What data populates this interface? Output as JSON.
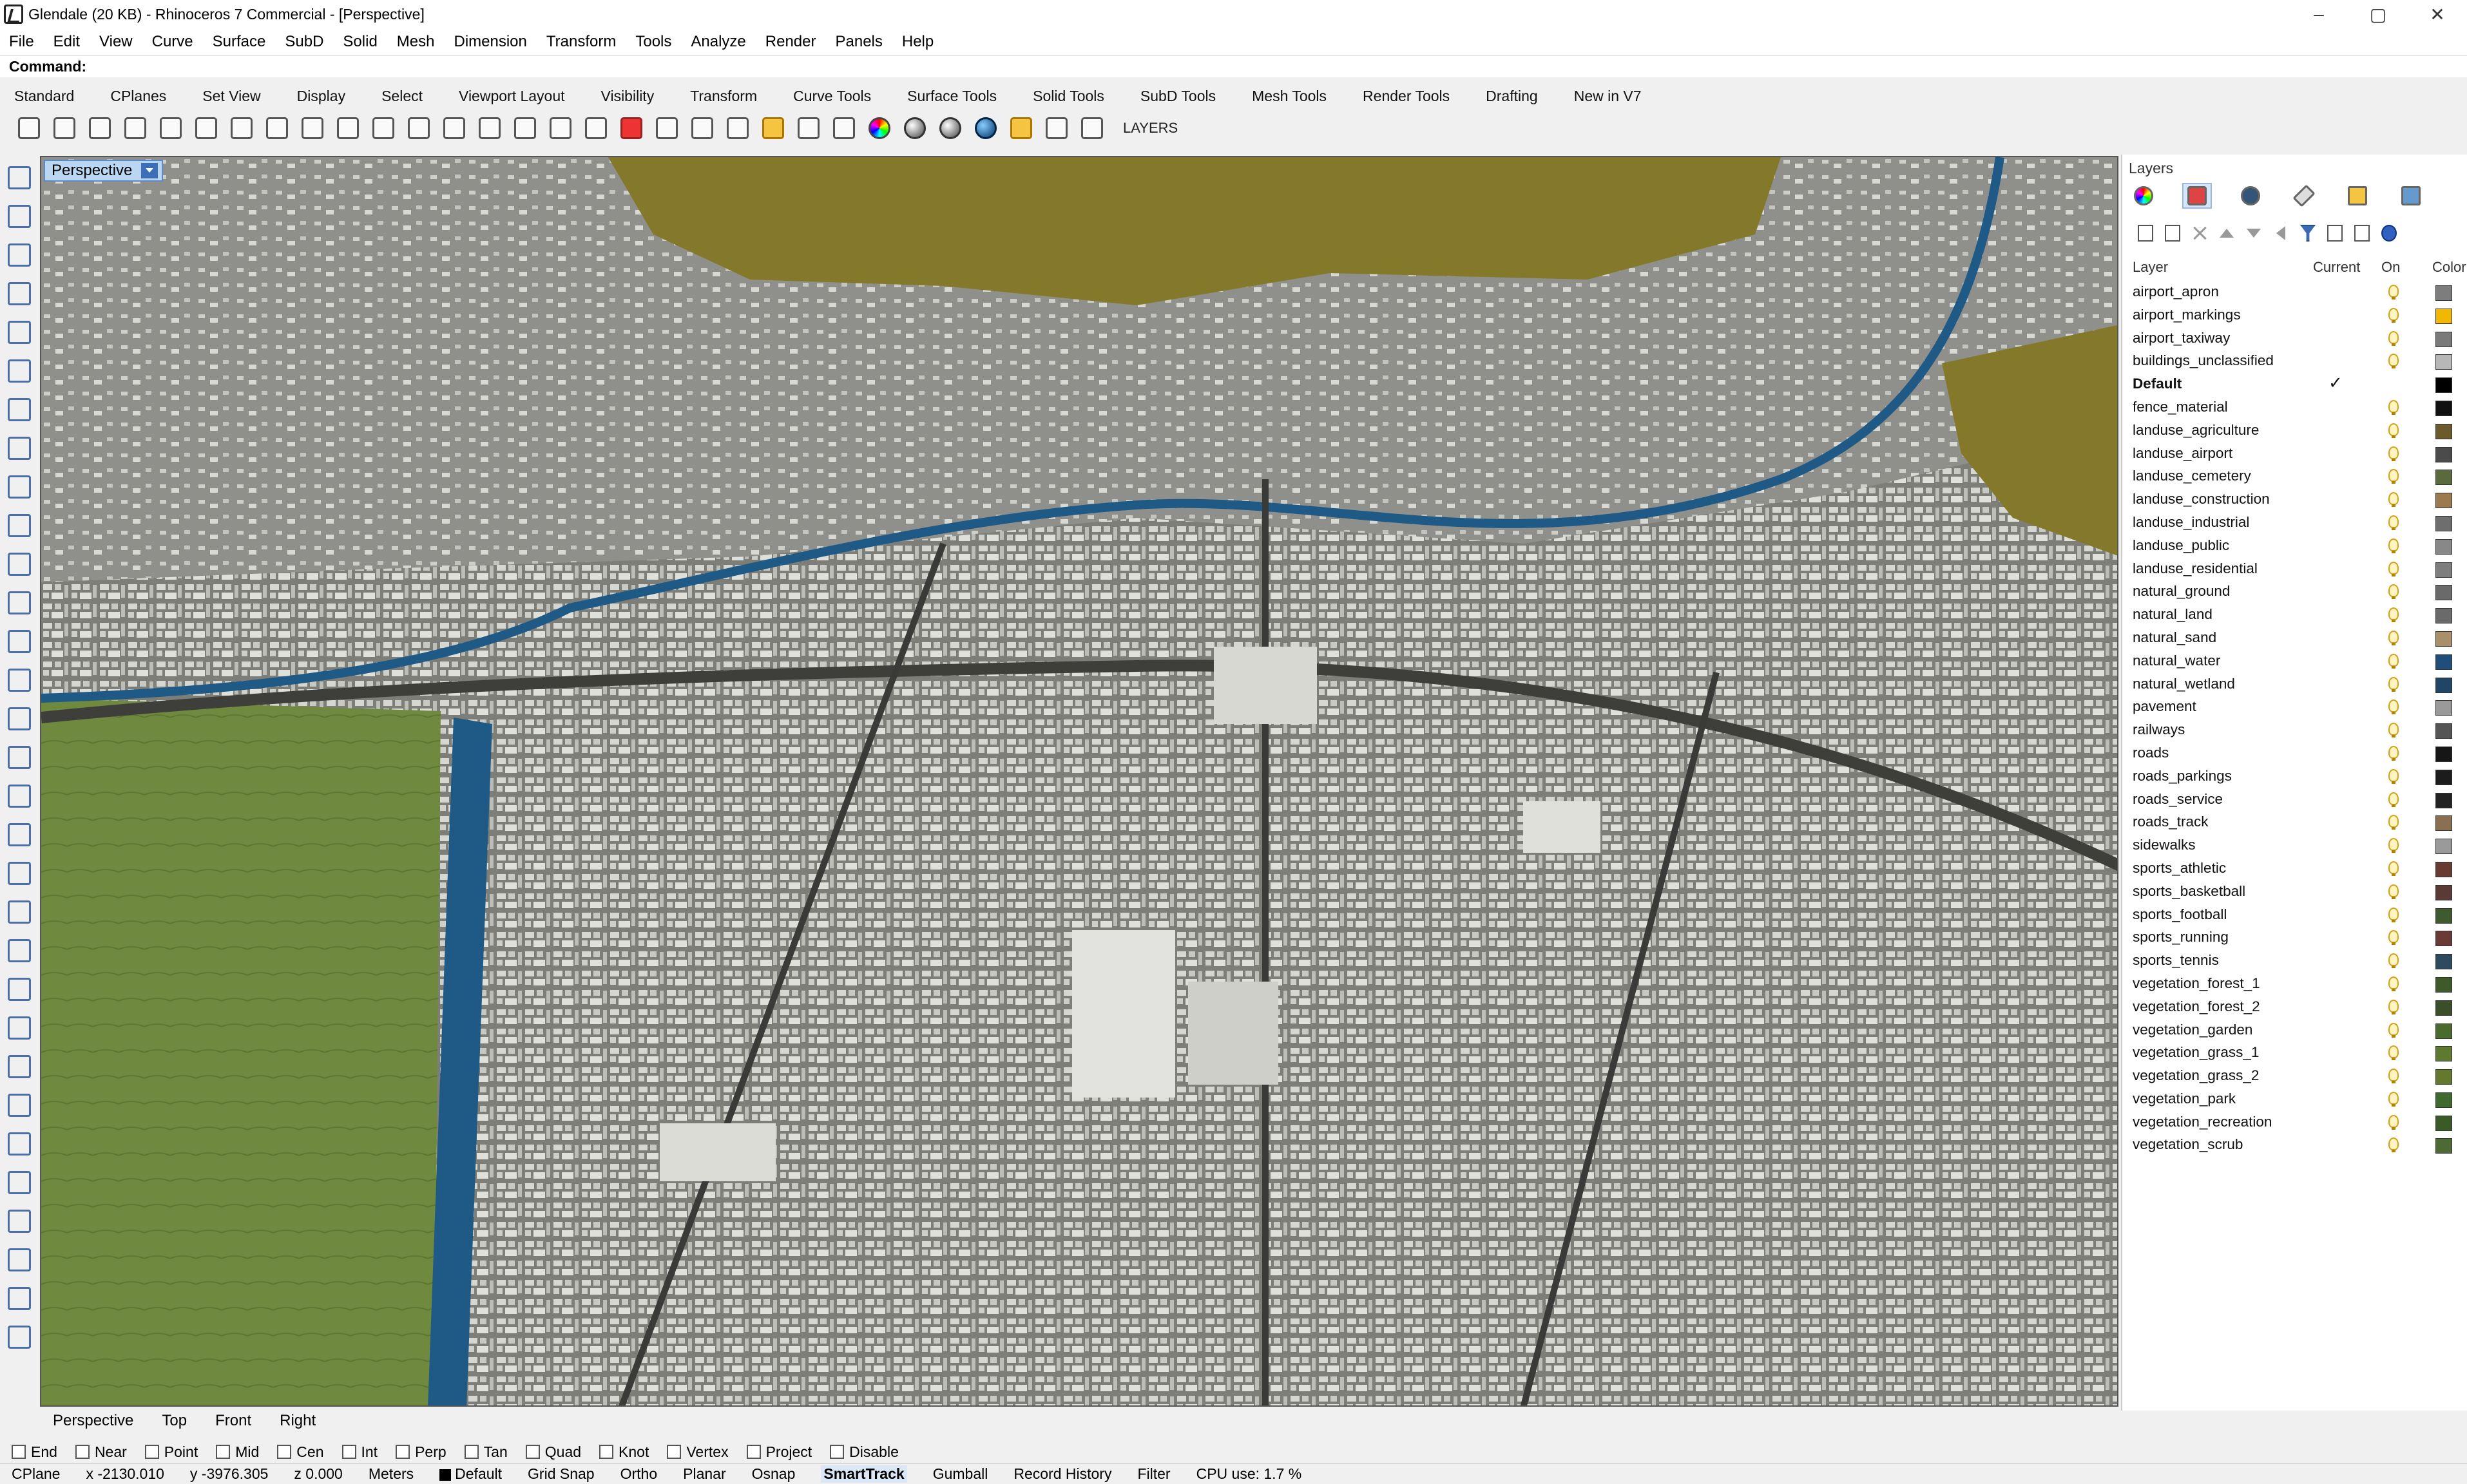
{
  "window": {
    "title": "Glendale (20 KB) - Rhinoceros 7 Commercial - [Perspective]",
    "controls": [
      "–",
      "▢",
      "✕"
    ]
  },
  "menu": [
    "File",
    "Edit",
    "View",
    "Curve",
    "Surface",
    "SubD",
    "Solid",
    "Mesh",
    "Dimension",
    "Transform",
    "Tools",
    "Analyze",
    "Render",
    "Panels",
    "Help"
  ],
  "command": {
    "label": "Command:",
    "value": ""
  },
  "toolbar_tabs": [
    "Standard",
    "CPlanes",
    "Set View",
    "Display",
    "Select",
    "Viewport Layout",
    "Visibility",
    "Transform",
    "Curve Tools",
    "Surface Tools",
    "Solid Tools",
    "SubD Tools",
    "Mesh Tools",
    "Render Tools",
    "Drafting",
    "New in V7"
  ],
  "toolbar": {
    "layers_label": "LAYERS",
    "icons": [
      "new-file-icon",
      "open-folder-icon",
      "save-icon",
      "print-icon",
      "import-icon",
      "cut-icon",
      "copy-icon",
      "paste-icon",
      "undo-icon",
      "pan-hand-icon",
      "move-view-icon",
      "zoom-icon",
      "zoom-window-icon",
      "zoom-extents-icon",
      "zoom-selected-icon",
      "rotate-view-icon",
      "four-viewports-icon",
      "car-icon",
      "grid-icon",
      "plane-icon",
      "options-icon",
      "light-bulb-icon",
      "lock-icon",
      "layer-swatch-icon",
      "color-wheel-icon",
      "shaded-sphere-icon",
      "rendered-sphere-icon",
      "blue-sphere-icon",
      "spotlight-icon",
      "gear-settings-icon",
      "snap-icon"
    ]
  },
  "viewport": {
    "label": "Perspective"
  },
  "viewport_tabs": [
    "Perspective",
    "Top",
    "Front",
    "Right"
  ],
  "osnaps": [
    {
      "label": "End",
      "checked": false
    },
    {
      "label": "Near",
      "checked": false
    },
    {
      "label": "Point",
      "checked": false
    },
    {
      "label": "Mid",
      "checked": false
    },
    {
      "label": "Cen",
      "checked": false
    },
    {
      "label": "Int",
      "checked": false
    },
    {
      "label": "Perp",
      "checked": false
    },
    {
      "label": "Tan",
      "checked": false
    },
    {
      "label": "Quad",
      "checked": false
    },
    {
      "label": "Knot",
      "checked": false
    },
    {
      "label": "Vertex",
      "checked": false
    },
    {
      "label": "Project",
      "checked": false
    },
    {
      "label": "Disable",
      "checked": false
    }
  ],
  "status": {
    "cplane": "CPlane",
    "x": "x -2130.010",
    "y": "y -3976.305",
    "z": "z 0.000",
    "units": "Meters",
    "layer": "Default",
    "grid_snap": "Grid Snap",
    "ortho": "Ortho",
    "planar": "Planar",
    "osnap": "Osnap",
    "smarttrack": "SmartTrack",
    "gumball": "Gumball",
    "record_history": "Record History",
    "filter": "Filter",
    "cpu": "CPU use: 1.7 %"
  },
  "layers_panel": {
    "title": "Layers",
    "columns": {
      "layer": "Layer",
      "current": "Current",
      "on": "On",
      "color": "Color"
    },
    "current_mark": "✓",
    "rows": [
      {
        "name": "airport_apron",
        "current": false,
        "color": "#7d7d7d"
      },
      {
        "name": "airport_markings",
        "current": false,
        "color": "#f0b800"
      },
      {
        "name": "airport_taxiway",
        "current": false,
        "color": "#7a7a7a"
      },
      {
        "name": "buildings_unclassified",
        "current": false,
        "color": "#b7b7b7"
      },
      {
        "name": "Default",
        "current": true,
        "color": "#000000"
      },
      {
        "name": "fence_material",
        "current": false,
        "color": "#111111"
      },
      {
        "name": "landuse_agriculture",
        "current": false,
        "color": "#6b5a2a"
      },
      {
        "name": "landuse_airport",
        "current": false,
        "color": "#4b4b4b"
      },
      {
        "name": "landuse_cemetery",
        "current": false,
        "color": "#5a6a3e"
      },
      {
        "name": "landuse_construction",
        "current": false,
        "color": "#9a7a4e"
      },
      {
        "name": "landuse_industrial",
        "current": false,
        "color": "#6e6e6e"
      },
      {
        "name": "landuse_public",
        "current": false,
        "color": "#888888"
      },
      {
        "name": "landuse_residential",
        "current": false,
        "color": "#7e7e7e"
      },
      {
        "name": "natural_ground",
        "current": false,
        "color": "#6a6a6a"
      },
      {
        "name": "natural_land",
        "current": false,
        "color": "#6a6a6a"
      },
      {
        "name": "natural_sand",
        "current": false,
        "color": "#a8906a"
      },
      {
        "name": "natural_water",
        "current": false,
        "color": "#1f4e7a"
      },
      {
        "name": "natural_wetland",
        "current": false,
        "color": "#1f4666"
      },
      {
        "name": "pavement",
        "current": false,
        "color": "#9a9a9a"
      },
      {
        "name": "railways",
        "current": false,
        "color": "#555555"
      },
      {
        "name": "roads",
        "current": false,
        "color": "#161616"
      },
      {
        "name": "roads_parkings",
        "current": false,
        "color": "#1c1c1c"
      },
      {
        "name": "roads_service",
        "current": false,
        "color": "#222222"
      },
      {
        "name": "roads_track",
        "current": false,
        "color": "#8a7050"
      },
      {
        "name": "sidewalks",
        "current": false,
        "color": "#9a9a9a"
      },
      {
        "name": "sports_athletic",
        "current": false,
        "color": "#6a3a30"
      },
      {
        "name": "sports_basketball",
        "current": false,
        "color": "#5a3a36"
      },
      {
        "name": "sports_football",
        "current": false,
        "color": "#3e5a2e"
      },
      {
        "name": "sports_running",
        "current": false,
        "color": "#6a3a36"
      },
      {
        "name": "sports_tennis",
        "current": false,
        "color": "#2e4a5e"
      },
      {
        "name": "vegetation_forest_1",
        "current": false,
        "color": "#3e5a2a"
      },
      {
        "name": "vegetation_forest_2",
        "current": false,
        "color": "#3a4e2a"
      },
      {
        "name": "vegetation_garden",
        "current": false,
        "color": "#4a6a2e"
      },
      {
        "name": "vegetation_grass_1",
        "current": false,
        "color": "#5e7a2e"
      },
      {
        "name": "vegetation_grass_2",
        "current": false,
        "color": "#64782e"
      },
      {
        "name": "vegetation_park",
        "current": false,
        "color": "#3e6a2e"
      },
      {
        "name": "vegetation_recreation",
        "current": false,
        "color": "#3a5a26"
      },
      {
        "name": "vegetation_scrub",
        "current": false,
        "color": "#4e6a34"
      }
    ]
  }
}
